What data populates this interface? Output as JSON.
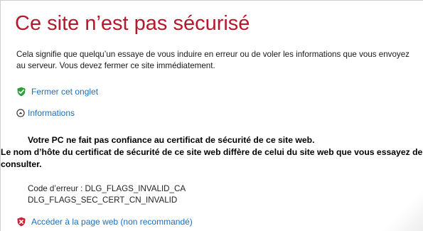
{
  "page": {
    "title": "Ce site n’est pas sécurisé",
    "description": "Cela signifie que quelqu’un essaye de vous induire en erreur ou de voler les informations que vous envoyez au serveur. Vous devez fermer ce site immédiatement."
  },
  "actions": {
    "close_tab": "Fermer cet onglet",
    "more_info": "Informations",
    "proceed": "Accéder à la page web (non recommandé)"
  },
  "details": {
    "line1": "Votre PC ne fait pas confiance au certificat de sécurité de ce site web.",
    "line2": "Le nom d’hôte du certificat de sécurité de ce site web diffère de celui du site web que vous essayez de consulter.",
    "error_code_line1": "Code d’erreur : DLG_FLAGS_INVALID_CA",
    "error_code_line2": "DLG_FLAGS_SEC_CERT_CN_INVALID"
  },
  "icons": {
    "close_tab": "green-shield-check-icon",
    "more_info": "circle-chevron-up-icon",
    "proceed": "red-shield-x-icon"
  },
  "colors": {
    "title": "#b5192b",
    "link": "#1a6fbd",
    "shield_ok": "#2e9d3a",
    "shield_bad": "#c9243a"
  }
}
